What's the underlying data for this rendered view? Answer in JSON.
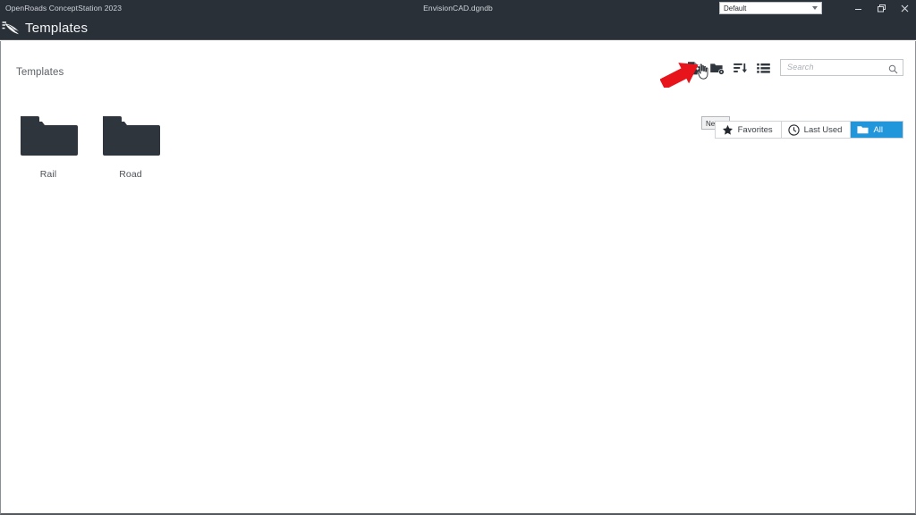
{
  "titlebar": {
    "app_name": "OpenRoads ConceptStation 2023",
    "document_name": "EnvisionCAD.dgndb",
    "workset": {
      "selected": "Default",
      "icon": "chevron-down-icon"
    },
    "window_controls": [
      {
        "name": "minimize",
        "icon": "minimize-icon"
      },
      {
        "name": "restore",
        "icon": "restore-icon"
      },
      {
        "name": "close",
        "icon": "close-icon"
      }
    ]
  },
  "header": {
    "logo_icon": "openroads-logo-icon",
    "title": "Templates"
  },
  "main": {
    "breadcrumb": "Templates",
    "toolbar": [
      {
        "name": "new-template",
        "icon": "new-template-icon",
        "tooltip": "New..."
      },
      {
        "name": "new-folder",
        "icon": "folder-settings-icon"
      },
      {
        "name": "sort",
        "icon": "sort-descending-icon"
      },
      {
        "name": "list-view",
        "icon": "list-view-icon"
      }
    ],
    "tooltip_text": "New...",
    "search": {
      "placeholder": "Search",
      "value": "",
      "icon": "search-icon"
    },
    "filters": [
      {
        "label": "Favorites",
        "icon": "star-icon",
        "active": false
      },
      {
        "label": "Last Used",
        "icon": "clock-icon",
        "active": false
      },
      {
        "label": "All",
        "icon": "folder-icon",
        "active": true
      }
    ],
    "folders": [
      {
        "label": "Rail",
        "icon": "folder-icon"
      },
      {
        "label": "Road",
        "icon": "folder-icon"
      }
    ]
  },
  "annotation": {
    "arrow": "red-arrow-pointing-up-right",
    "color": "#e8141c"
  },
  "colors": {
    "titlebar_bg": "#2a3038",
    "header_bg": "#2a3038",
    "content_bg": "#ffffff",
    "accent_blue": "#2196da",
    "folder_fill": "#2e353c",
    "text_muted": "#5c6167",
    "annotation_red": "#e8141c"
  }
}
